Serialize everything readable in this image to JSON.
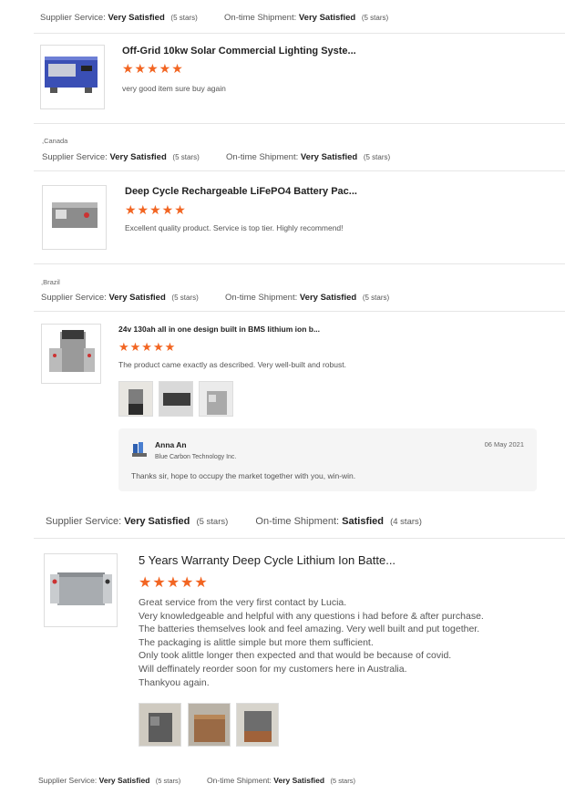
{
  "labels": {
    "supplier_service": "Supplier Service:",
    "ontime_shipment": "On-time Shipment:"
  },
  "reviews": [
    {
      "supplier_value": "Very Satisfied",
      "supplier_stars": "(5 stars)",
      "shipment_value": "Very Satisfied",
      "shipment_stars": "(5 stars)",
      "title": "Off-Grid 10kw Solar Commercial Lighting Syste...",
      "stars": "★★★★★",
      "text": "very good item sure buy again"
    },
    {
      "country": ",Canada",
      "supplier_value": "Very Satisfied",
      "supplier_stars": "(5 stars)",
      "shipment_value": "Very Satisfied",
      "shipment_stars": "(5 stars)",
      "title": "Deep Cycle Rechargeable LiFePO4 Battery Pac...",
      "stars": "★★★★★",
      "text": "Excellent quality product.  Service is top tier.  Highly recommend!"
    },
    {
      "country": ",Brazil",
      "supplier_value": "Very Satisfied",
      "supplier_stars": "(5 stars)",
      "shipment_value": "Very Satisfied",
      "shipment_stars": "(5 stars)",
      "title": "24v 130ah all in one design built in BMS lithium ion b...",
      "stars": "★★★★★",
      "text": "The product came exactly as described. Very well-built and robust.",
      "reply": {
        "name": "Anna An",
        "company": "Blue Carbon Technology Inc.",
        "date": "06 May 2021",
        "text": "Thanks sir, hope to occupy the market together with you, win-win."
      }
    },
    {
      "supplier_value": "Very Satisfied",
      "supplier_stars": "(5 stars)",
      "shipment_value": "Satisfied",
      "shipment_stars": "(4 stars)",
      "title": "5 Years Warranty Deep Cycle Lithium Ion Batte...",
      "stars": "★★★★★",
      "text_lines": [
        "Great service from the very first contact by Lucia.",
        "Very knowledgeable and helpful with any questions i had before & after purchase.",
        "The batteries themselves look and feel amazing. Very well built and put together.",
        "The packaging is alittle simple but more them sufficient.",
        "Only took alittle longer then expected and that would be because of covid.",
        "Will deffinately reorder soon for my customers here in Australia.",
        "Thankyou again."
      ]
    },
    {
      "supplier_value": "Very Satisfied",
      "supplier_stars": "(5 stars)",
      "shipment_value": "Very Satisfied",
      "shipment_stars": "(5 stars)"
    }
  ]
}
